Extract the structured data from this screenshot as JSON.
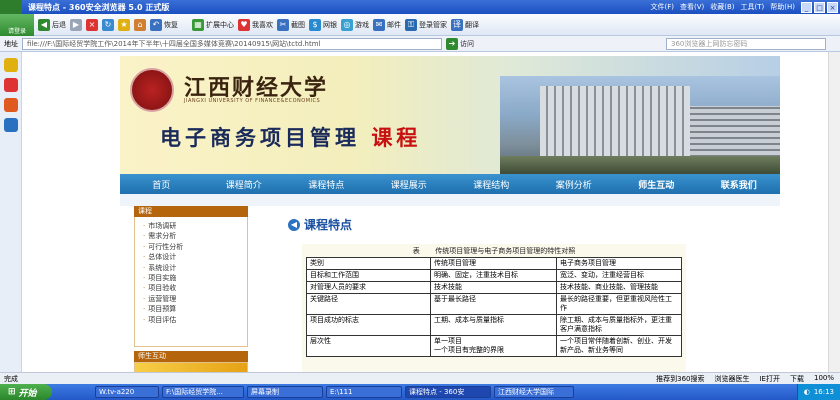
{
  "window": {
    "title": "课程特点 - 360安全浏览器 5.0 正式版",
    "menus": [
      "文件(F)",
      "查看(V)",
      "收藏(B)",
      "工具(T)",
      "帮助(H)"
    ],
    "win_buttons": [
      "_",
      "□",
      "×"
    ]
  },
  "toolbar": {
    "login_label": "请登录",
    "back": "后退",
    "restore": "恢复",
    "ext_center": "扩展中心",
    "favorites": "我喜欢",
    "screenshot": "截图",
    "netbank": "网银",
    "games": "游戏",
    "mail": "邮件",
    "login_mgr": "登录管家",
    "translate": "翻译"
  },
  "address": {
    "label": "地址",
    "url": "file:///F:\\国际经贸学院工作\\2014年下半年\\十四届全国多媒体竞赛\\20140915\\网站\\tctd.html",
    "go": "访问",
    "search_placeholder": "360浏览器上网防忘密码"
  },
  "site": {
    "university_cn": "江西财经大学",
    "university_en": "JIANGXI UNIVERSITY OF FINANCE&ECONOMICS",
    "course_title": "电子商务项目管理",
    "course_suffix": "课程",
    "nav": [
      "首页",
      "课程简介",
      "课程特点",
      "课程展示",
      "课程结构",
      "案例分析",
      "师生互动",
      "联系我们"
    ],
    "left_head": "课程",
    "left_items": [
      "市场调研",
      "需求分析",
      "可行性分析",
      "总体设计",
      "系统设计",
      "项目实施",
      "项目验收",
      "运营管理",
      "项目预算",
      "项目评估"
    ],
    "left_head2": "师生互动",
    "section_title": "课程特点",
    "table_caption_prefix": "表",
    "table_caption": "传统项目管理与电子商务项目管理的特性对照",
    "table_rows": [
      [
        "类别",
        "传统项目管理",
        "电子商务项目管理"
      ],
      [
        "目标和工作范围",
        "明确、固定，注重技术目标",
        "宽泛、变动，注重经营目标"
      ],
      [
        "对管理人员的要求",
        "技术技能",
        "技术技能、商业技能、管理技能"
      ],
      [
        "关键路径",
        "基于最长路径",
        "最长的路径重要，但更重视风险性工作"
      ],
      [
        "项目成功的标志",
        "工期、成本与质量指标",
        "除工期、成本与质量指标外，更注重客户满意指标"
      ],
      [
        "层次性",
        "单一项目\n一个项目有完整的界限",
        "一个项目常伴随着创新、创业、开发新产品、新业务等同"
      ]
    ]
  },
  "status": {
    "left": "完成",
    "items": [
      "推荐到360搜索",
      "浏览器医生",
      "IE打开",
      "下载",
      "100%"
    ]
  },
  "taskbar": {
    "start": "开始",
    "tasks": [
      "W.tv-a220",
      "F:\\国际经贸学院...",
      "屏幕录制",
      "E:\\111",
      "课程特点 - 360安",
      "江西财经大学国际"
    ],
    "clock": "16:13"
  }
}
